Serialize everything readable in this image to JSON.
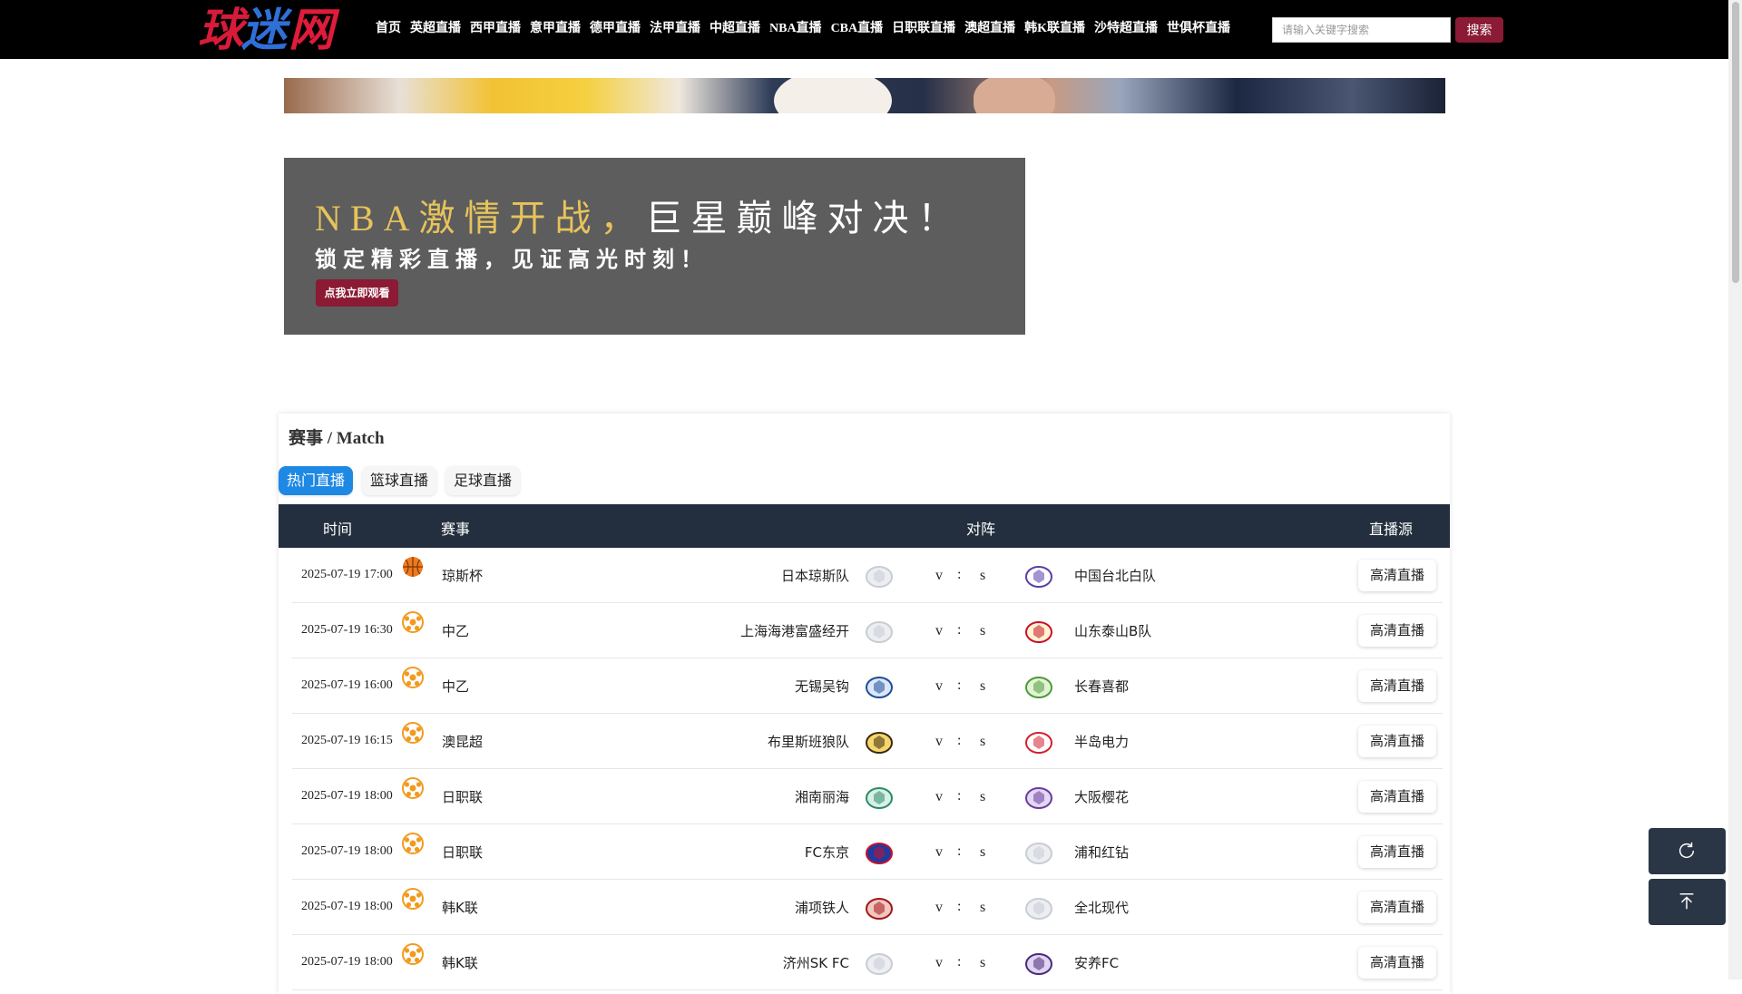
{
  "site": {
    "logo_chars": [
      "球",
      "迷",
      "网"
    ]
  },
  "nav": {
    "items": [
      "首页",
      "英超直播",
      "西甲直播",
      "意甲直播",
      "德甲直播",
      "法甲直播",
      "中超直播",
      "NBA直播",
      "CBA直播",
      "日职联直播",
      "澳超直播",
      "韩K联直播",
      "沙特超直播",
      "世俱杯直播"
    ],
    "search_placeholder": "请输入关键字搜索",
    "search_label": "搜索"
  },
  "promo": {
    "title_lead": "NBA激情开战，",
    "title_tail": "巨星巅峰对决！",
    "subtitle": "锁定精彩直播，见证高光时刻！",
    "button": "点我立即观看"
  },
  "matches": {
    "title": "赛事 / Match",
    "tabs": [
      "热门直播",
      "篮球直播",
      "足球直播"
    ],
    "active_tab": "热门直播",
    "columns": {
      "time": "时间",
      "league": "赛事",
      "matchup": "对阵",
      "source": "直播源"
    },
    "vs": [
      "v",
      ":",
      "s"
    ],
    "rows": [
      {
        "time": "2025-07-19 17:00",
        "sport": "basketball",
        "league": "琼斯杯",
        "home": "日本琼斯队",
        "away": "中国台北白队",
        "home_logo": "placeholder-logo",
        "away_logo": "taipei-logo",
        "source": "高清直播"
      },
      {
        "time": "2025-07-19 16:30",
        "sport": "football",
        "league": "中乙",
        "home": "上海海港富盛经开",
        "away": "山东泰山B队",
        "home_logo": "placeholder-logo",
        "away_logo": "taishan-logo",
        "source": "高清直播"
      },
      {
        "time": "2025-07-19 16:00",
        "sport": "football",
        "league": "中乙",
        "home": "无锡吴钩",
        "away": "长春喜都",
        "home_logo": "wuxi-logo",
        "away_logo": "changchun-logo",
        "source": "高清直播"
      },
      {
        "time": "2025-07-19 16:15",
        "sport": "football",
        "league": "澳昆超",
        "home": "布里斯班狼队",
        "away": "半岛电力",
        "home_logo": "wolves-logo",
        "away_logo": "peninsula-logo",
        "source": "高清直播"
      },
      {
        "time": "2025-07-19 18:00",
        "sport": "football",
        "league": "日职联",
        "home": "湘南丽海",
        "away": "大阪樱花",
        "home_logo": "shonan-logo",
        "away_logo": "cerezo-logo",
        "source": "高清直播"
      },
      {
        "time": "2025-07-19 18:00",
        "sport": "football",
        "league": "日职联",
        "home": "FC东京",
        "away": "浦和红钻",
        "home_logo": "fctokyo-logo",
        "away_logo": "placeholder-logo",
        "source": "高清直播"
      },
      {
        "time": "2025-07-19 18:00",
        "sport": "football",
        "league": "韩K联",
        "home": "浦项铁人",
        "away": "全北现代",
        "home_logo": "pohang-logo",
        "away_logo": "placeholder-logo",
        "source": "高清直播"
      },
      {
        "time": "2025-07-19 18:00",
        "sport": "football",
        "league": "韩K联",
        "home": "济州SK FC",
        "away": "安养FC",
        "home_logo": "placeholder-logo",
        "away_logo": "anyang-logo",
        "source": "高清直播"
      }
    ]
  },
  "colors": {
    "accent": "#8b1a34",
    "tab_active": "#1e88e5",
    "table_header": "#232f3e",
    "nav_bg": "#000000"
  }
}
